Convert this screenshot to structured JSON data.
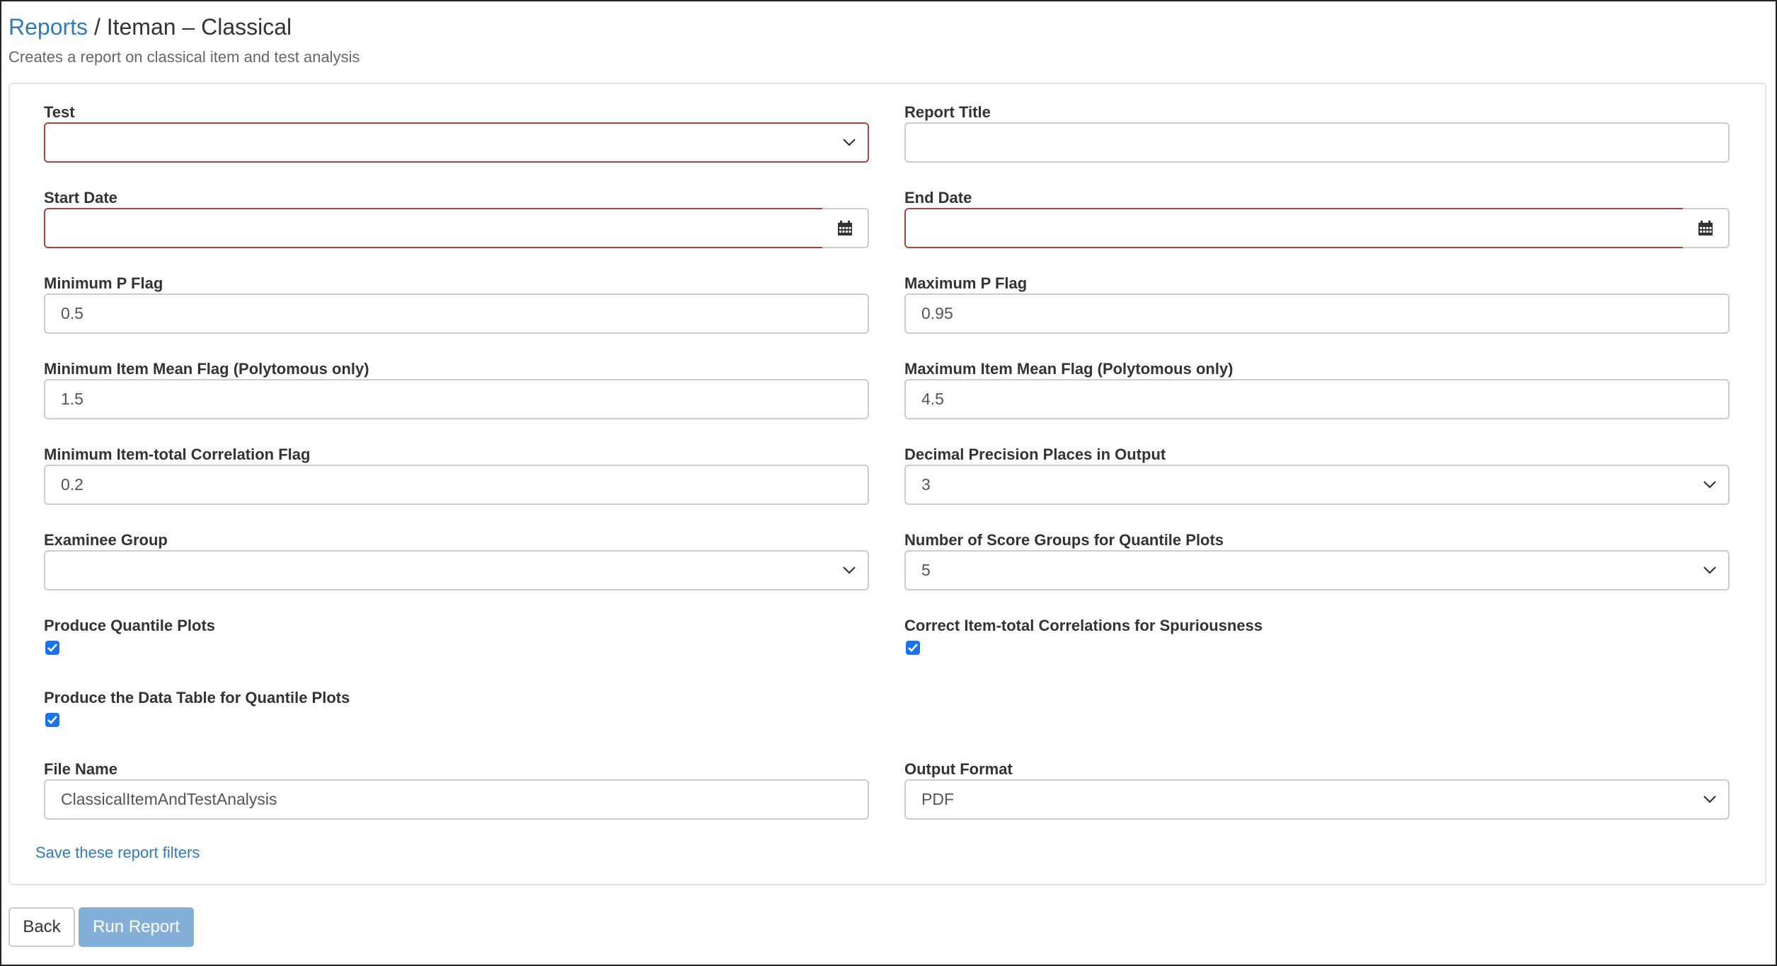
{
  "breadcrumb": {
    "root": "Reports",
    "separator": "/",
    "current": "Iteman – Classical"
  },
  "subtitle": "Creates a report on classical item and test analysis",
  "fields": {
    "test": {
      "label": "Test",
      "value": ""
    },
    "report_title": {
      "label": "Report Title",
      "value": ""
    },
    "start_date": {
      "label": "Start Date",
      "value": ""
    },
    "end_date": {
      "label": "End Date",
      "value": ""
    },
    "min_p_flag": {
      "label": "Minimum P Flag",
      "value": "0.5"
    },
    "max_p_flag": {
      "label": "Maximum P Flag",
      "value": "0.95"
    },
    "min_item_mean": {
      "label": "Minimum Item Mean Flag (Polytomous only)",
      "value": "1.5"
    },
    "max_item_mean": {
      "label": "Maximum Item Mean Flag (Polytomous only)",
      "value": "4.5"
    },
    "min_item_total_corr": {
      "label": "Minimum Item-total Correlation Flag",
      "value": "0.2"
    },
    "decimal_precision": {
      "label": "Decimal Precision Places in Output",
      "value": "3"
    },
    "examinee_group": {
      "label": "Examinee Group",
      "value": ""
    },
    "score_groups": {
      "label": "Number of Score Groups for Quantile Plots",
      "value": "5"
    },
    "produce_quantile_plots": {
      "label": "Produce Quantile Plots",
      "checked": true
    },
    "correct_spuriousness": {
      "label": "Correct Item-total Correlations for Spuriousness",
      "checked": true
    },
    "produce_data_table": {
      "label": "Produce the Data Table for Quantile Plots",
      "checked": true
    },
    "file_name": {
      "label": "File Name",
      "value": "ClassicalItemAndTestAnalysis"
    },
    "output_format": {
      "label": "Output Format",
      "value": "PDF"
    }
  },
  "save_filters_link": "Save these report filters",
  "buttons": {
    "back": "Back",
    "run": "Run Report"
  },
  "colors": {
    "error_border": "#a94442",
    "link": "#337ab7",
    "run_button": "#84afd8",
    "checkbox": "#1a73e8"
  },
  "icons": {
    "select": "chevron-down-icon",
    "date": "calendar-icon",
    "checkbox": "checkmark-icon"
  }
}
